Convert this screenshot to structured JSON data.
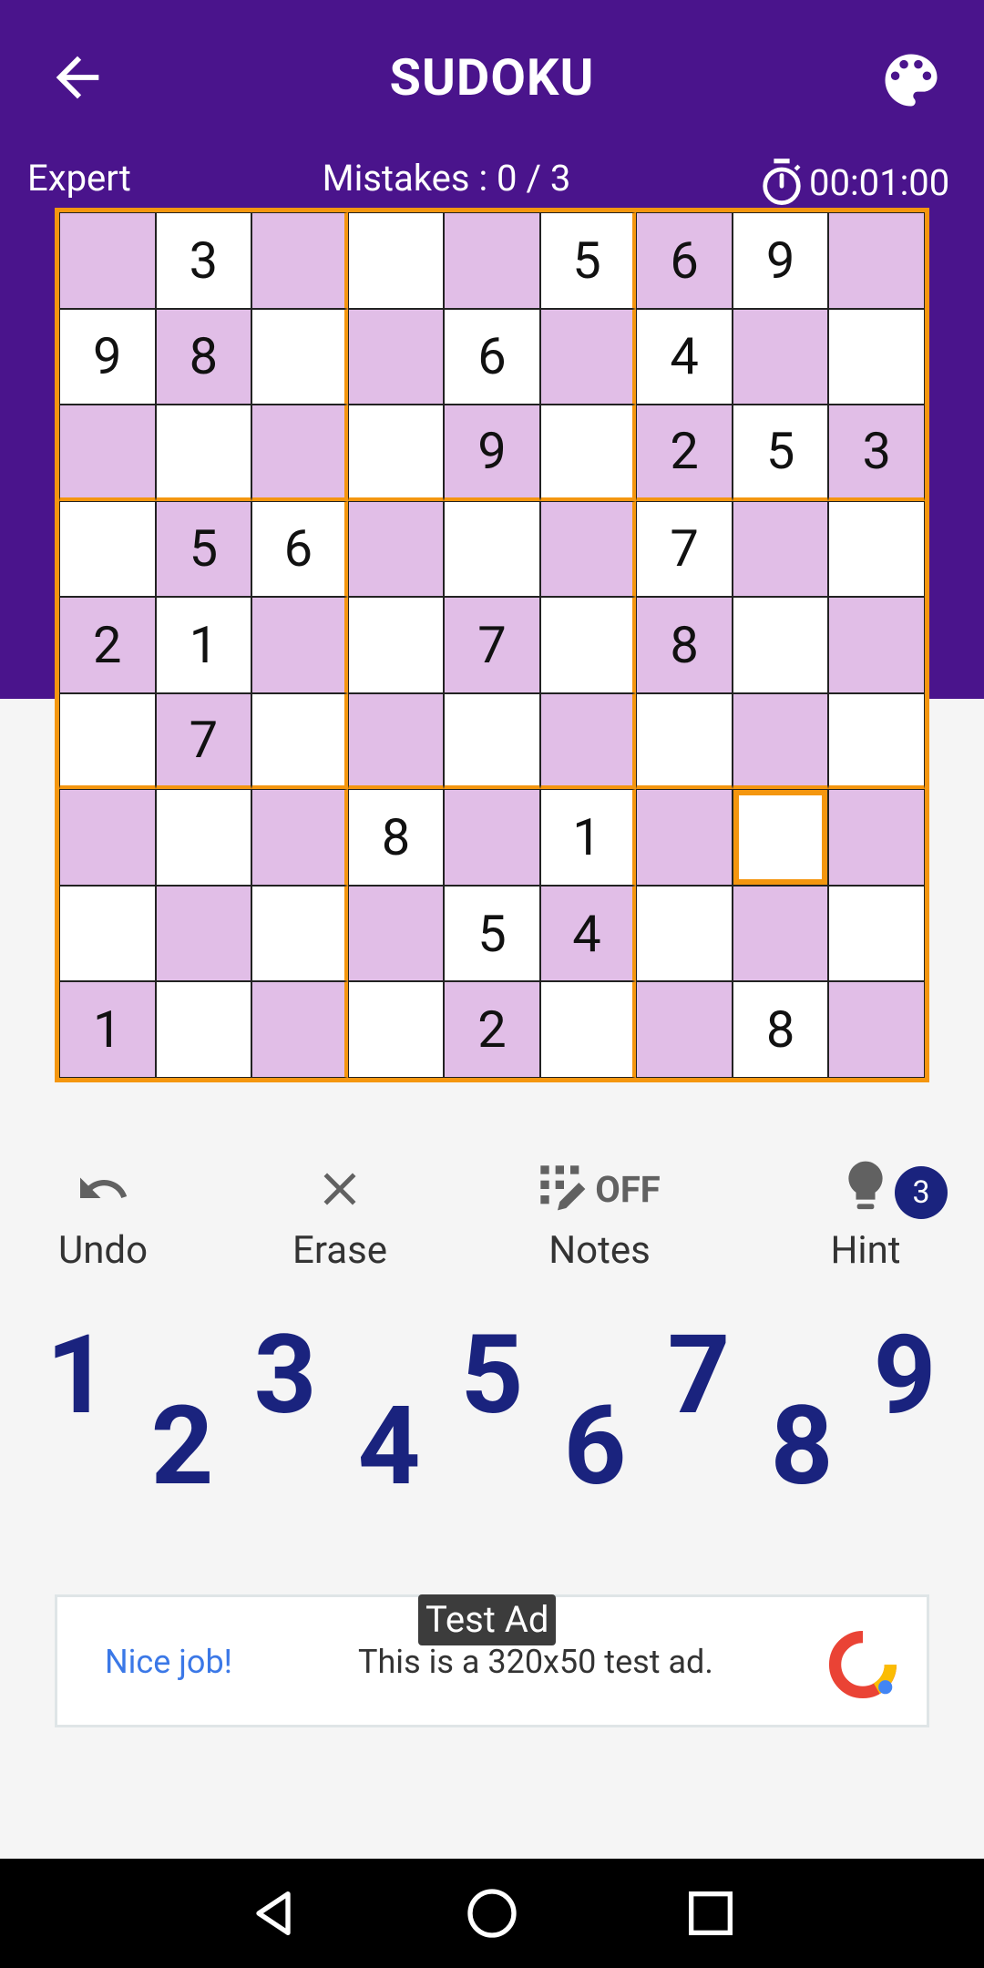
{
  "header": {
    "title": "SUDOKU",
    "back_icon": "arrow-left-icon",
    "palette_icon": "palette-icon"
  },
  "status": {
    "level": "Expert",
    "mistakes": "Mistakes : 0 / 3",
    "timer": "00:01:00",
    "timer_icon": "stopwatch-icon"
  },
  "board": {
    "rows": [
      [
        "",
        "3",
        "",
        "",
        "",
        "5",
        "6",
        "9",
        ""
      ],
      [
        "9",
        "8",
        "",
        "",
        "6",
        "",
        "4",
        "",
        ""
      ],
      [
        "",
        "",
        "",
        "",
        "9",
        "",
        "2",
        "5",
        "3"
      ],
      [
        "",
        "5",
        "6",
        "",
        "",
        "",
        "7",
        "",
        ""
      ],
      [
        "2",
        "1",
        "",
        "",
        "7",
        "",
        "8",
        "",
        ""
      ],
      [
        "",
        "7",
        "",
        "",
        "",
        "",
        "",
        "",
        ""
      ],
      [
        "",
        "",
        "",
        "8",
        "",
        "1",
        "",
        "",
        ""
      ],
      [
        "",
        "",
        "",
        "",
        "5",
        "4",
        "",
        "",
        ""
      ],
      [
        "1",
        "",
        "",
        "",
        "2",
        "",
        "",
        "8",
        ""
      ]
    ],
    "selected": {
      "row": 7,
      "col": 8
    },
    "colors": {
      "shade": "#e1bee7",
      "border": "#f4960f",
      "plain": "#ffffff"
    }
  },
  "tools": {
    "undo": "Undo",
    "erase": "Erase",
    "notes": "Notes",
    "notes_state": "OFF",
    "hint": "Hint",
    "hint_count": "3"
  },
  "numpad": [
    "1",
    "2",
    "3",
    "4",
    "5",
    "6",
    "7",
    "8",
    "9"
  ],
  "ad": {
    "tag": "Test Ad",
    "nice": "Nice job!",
    "text": "This is a 320x50 test ad."
  },
  "colors": {
    "topbar": "#4a148c",
    "numpad": "#1a237e"
  }
}
